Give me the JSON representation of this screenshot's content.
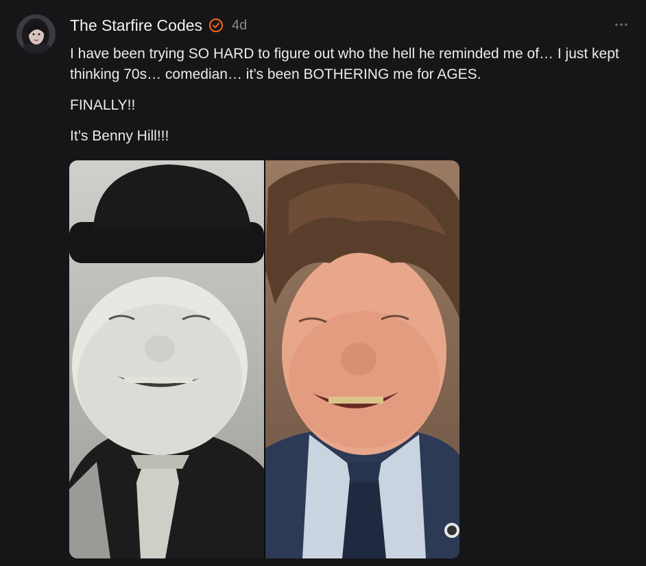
{
  "post": {
    "author": "The Starfire Codes",
    "time": "4d",
    "verified_icon": "verified-badge-icon",
    "more_icon": "ellipsis-icon",
    "text_line1": "I have been trying SO HARD to figure out who the hell he reminded me of… I just kept thinking 70s… comedian… it’s been BOTHERING me for AGES.",
    "text_line2": "FINALLY!!",
    "text_line3": "It’s Benny Hill!!!"
  },
  "colors": {
    "background": "#161618",
    "text": "#ececec",
    "muted": "#8a8a8e",
    "accent": "#ff6719"
  }
}
